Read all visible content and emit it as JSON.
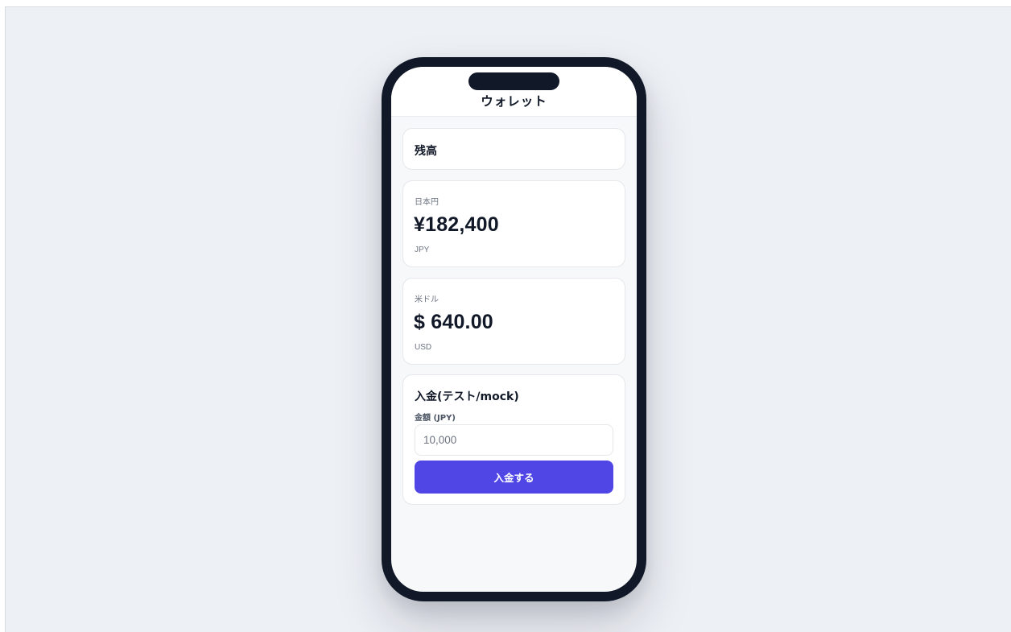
{
  "header": {
    "title": "ウォレット"
  },
  "balance": {
    "heading": "残高",
    "jpy": {
      "label": "日本円",
      "amount": "¥182,400",
      "code": "JPY"
    },
    "usd": {
      "label": "米ドル",
      "amount": "$ 640.00",
      "code": "USD"
    }
  },
  "deposit": {
    "title": "入金(テスト/mock)",
    "field_label": "金額 (JPY)",
    "placeholder": "10,000",
    "button_label": "入金する"
  },
  "colors": {
    "accent": "#4f46e5",
    "frame": "#111827",
    "background": "#edf0f5"
  }
}
